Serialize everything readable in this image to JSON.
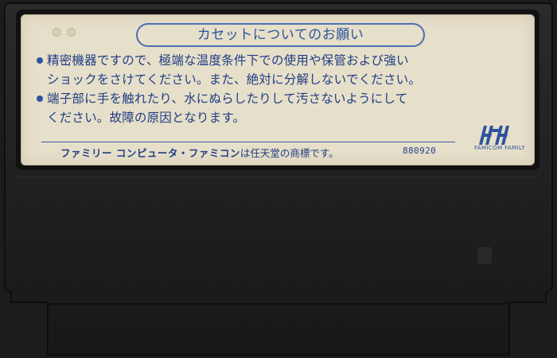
{
  "label": {
    "title": "カセットについてのお願い",
    "notes": [
      {
        "line1": "精密機器ですので、極端な温度条件下での使用や保管および強い",
        "line2": "ショックをさけてください。また、絶対に分解しないでください。"
      },
      {
        "line1": "端子部に手を触れたり、水にぬらしたりして汚さないようにして",
        "line2": "ください。故障の原因となります。"
      }
    ],
    "trademark_names": "ファミリー コンピュータ・ファミコン",
    "trademark_suffix": "は任天堂の商標です。",
    "lot_code": "880920",
    "logo_caption": "FAMICOM FAMILY"
  },
  "colors": {
    "label_background": "#e6dfc9",
    "ink_blue": "#1f3c86",
    "cartridge_plastic": "#1c1c1c"
  }
}
